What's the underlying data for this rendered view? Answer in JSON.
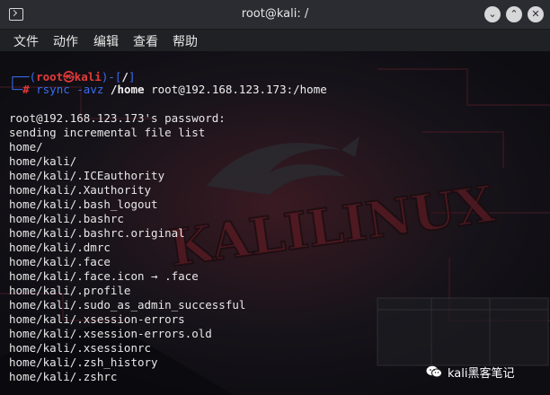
{
  "window": {
    "title": "root@kali: /",
    "minimize_glyph": "⌄",
    "maximize_glyph": "⌃",
    "close_glyph": "✕"
  },
  "menu": {
    "items": [
      "文件",
      "动作",
      "编辑",
      "查看",
      "帮助"
    ]
  },
  "prompt": {
    "open": "┌──(",
    "user": "root㉿kali",
    "mid": ")-[",
    "path": "/",
    "close": "]",
    "second": "└─",
    "hash": "# ",
    "command": "rsync -avz",
    "arg1": "/home",
    "arg2": " root@192.168.123.173:/home"
  },
  "output": [
    "root@192.168.123.173's password:",
    "sending incremental file list",
    "home/",
    "home/kali/",
    "home/kali/.ICEauthority",
    "home/kali/.Xauthority",
    "home/kali/.bash_logout",
    "home/kali/.bashrc",
    "home/kali/.bashrc.original",
    "home/kali/.dmrc",
    "home/kali/.face",
    "home/kali/.face.icon → .face",
    "home/kali/.profile",
    "home/kali/.sudo_as_admin_successful",
    "home/kali/.xsession-errors",
    "home/kali/.xsession-errors.old",
    "home/kali/.xsessionrc",
    "home/kali/.zsh_history",
    "home/kali/.zshrc"
  ],
  "watermark": {
    "text": "kali黑客笔记",
    "icon": "wechat-icon"
  },
  "colors": {
    "prompt_blue": "#3a6df0",
    "prompt_red": "#e33a3a",
    "terminal_bg": "#0f0f14",
    "titlebar_bg": "#2b2c31"
  }
}
